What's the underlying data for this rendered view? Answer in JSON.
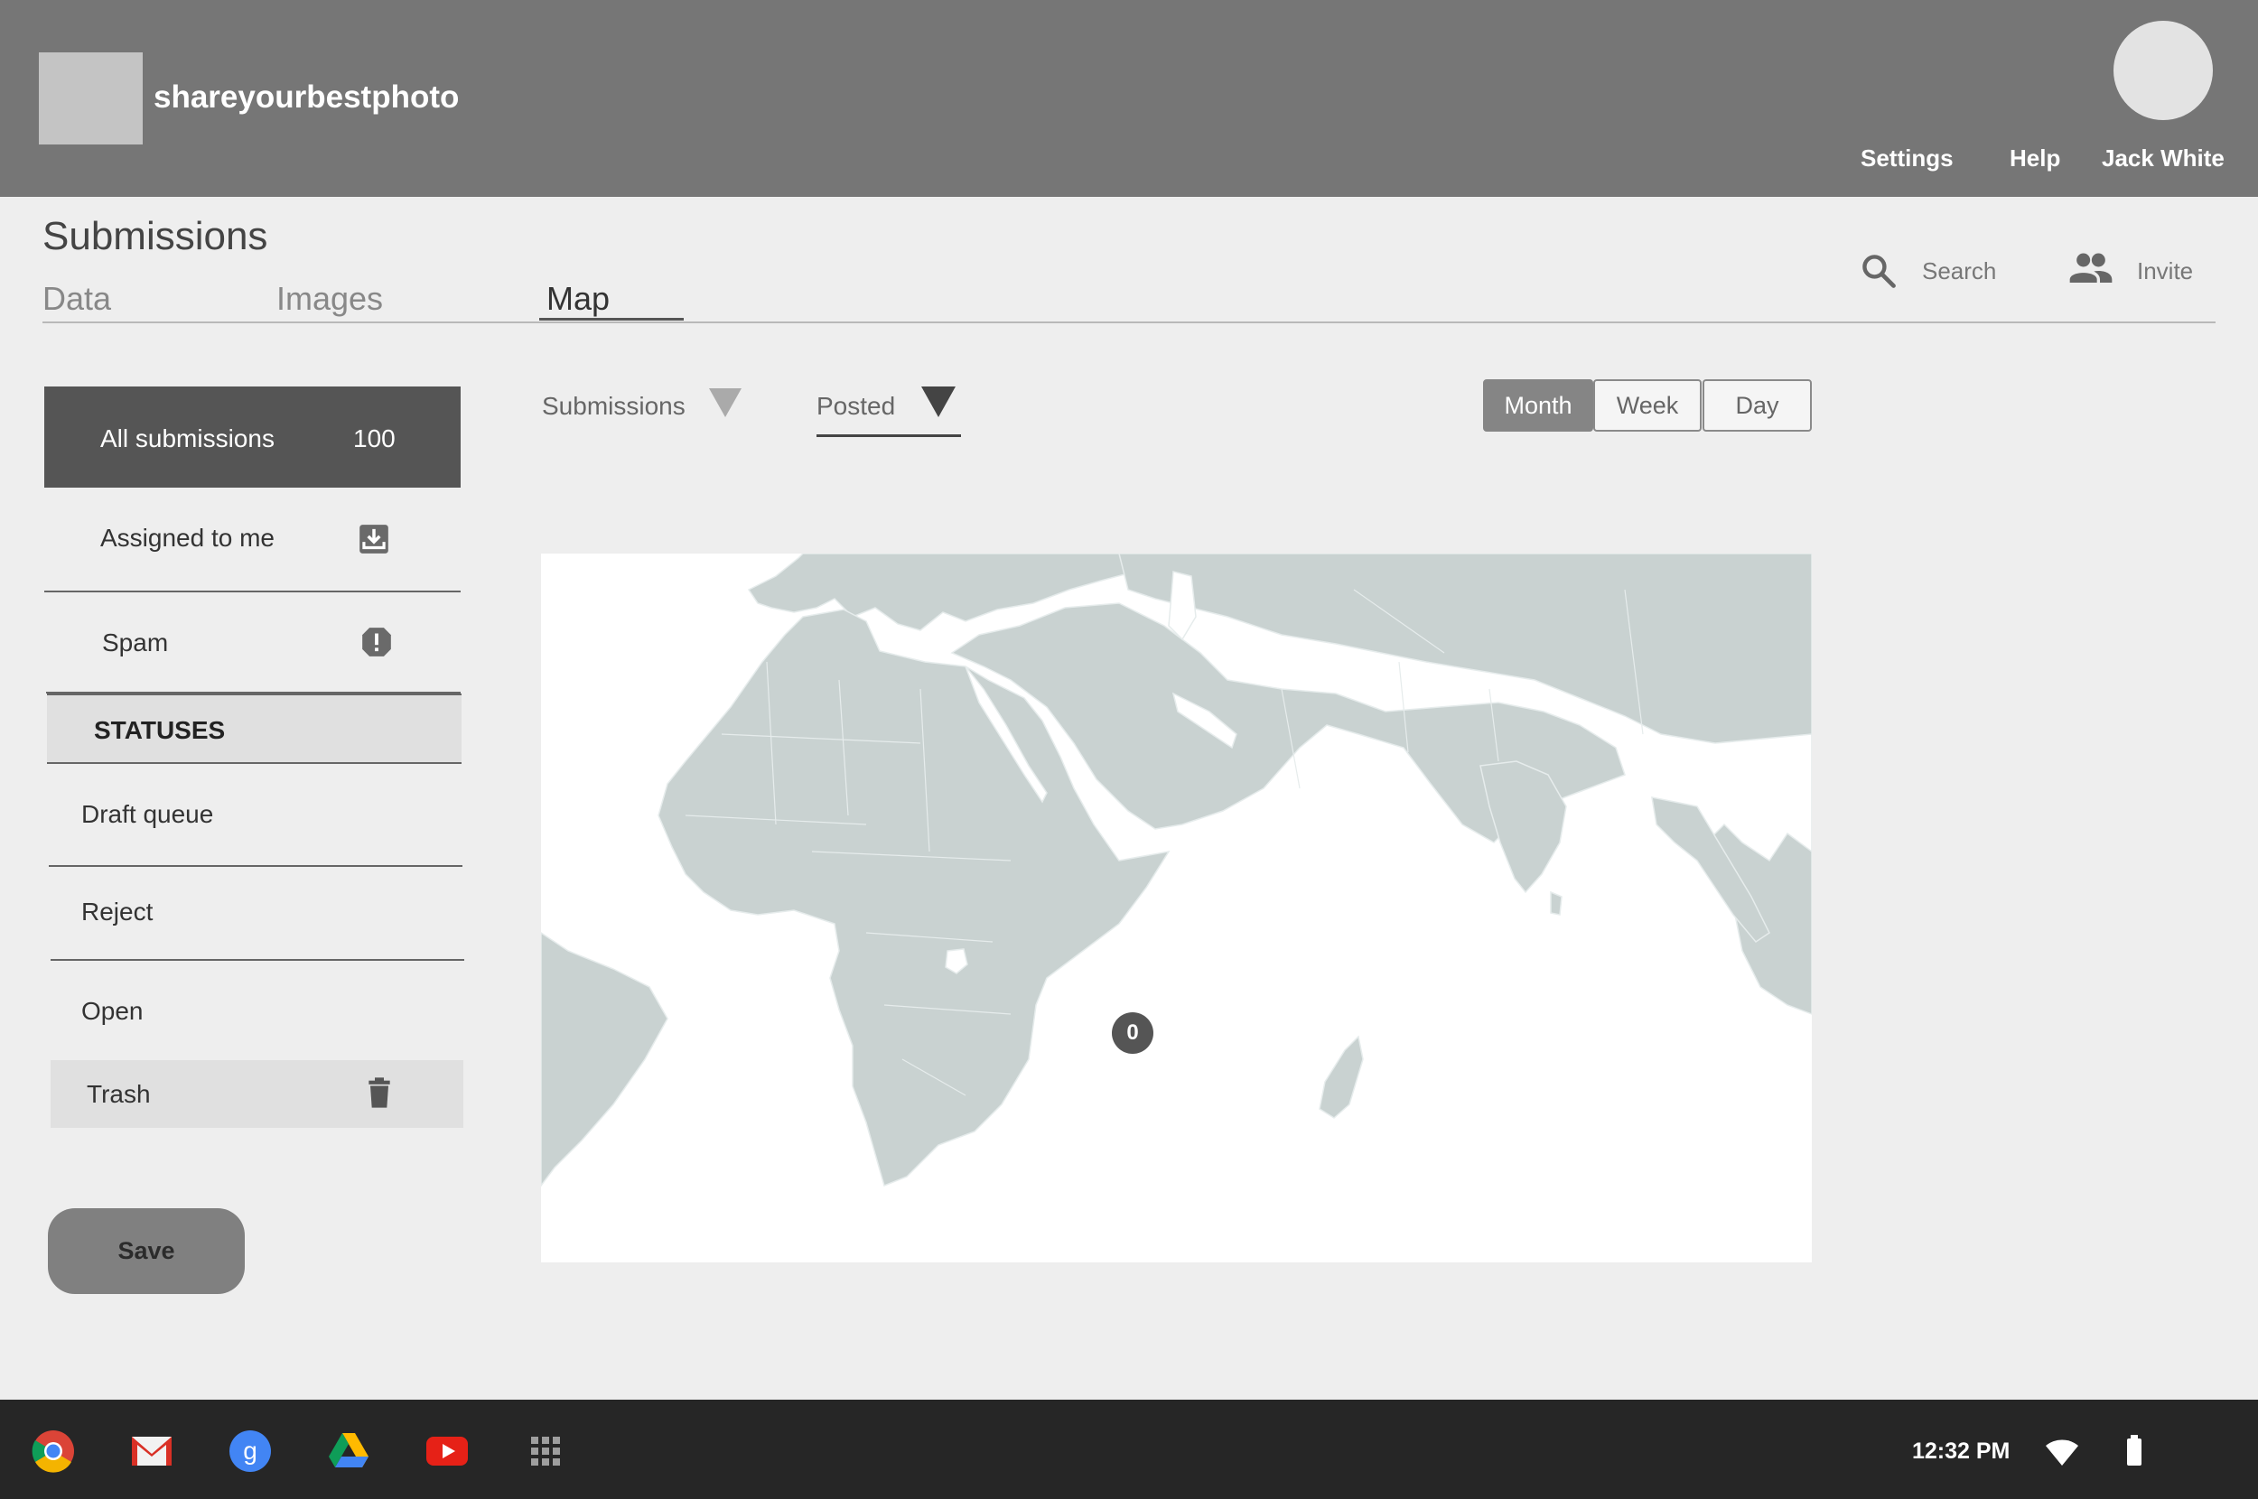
{
  "header": {
    "app_title": "shareyourbestphoto",
    "settings_label": "Settings",
    "help_label": "Help",
    "user_name": "Jack White"
  },
  "page": {
    "title": "Submissions",
    "tabs": [
      {
        "label": "Data",
        "active": false
      },
      {
        "label": "Images",
        "active": false
      },
      {
        "label": "Map",
        "active": true
      }
    ],
    "search_label": "Search",
    "invite_label": "Invite"
  },
  "sidebar": {
    "all_submissions": {
      "label": "All submissions",
      "count": "100"
    },
    "assigned_to_me": {
      "label": "Assigned to me",
      "icon": "inbox-download-icon"
    },
    "spam": {
      "label": "Spam",
      "icon": "alert-octagon-icon"
    },
    "statuses_header": "STATUSES",
    "statuses": [
      {
        "label": "Draft queue"
      },
      {
        "label": "Reject"
      },
      {
        "label": "Open"
      }
    ],
    "trash": {
      "label": "Trash",
      "icon": "trash-icon"
    },
    "save_label": "Save"
  },
  "filters": {
    "submissions_label": "Submissions",
    "posted_label": "Posted",
    "period": {
      "options": [
        "Month",
        "Week",
        "Day"
      ],
      "selected": "Month"
    }
  },
  "map": {
    "region": "Africa, Middle East and South Asia",
    "marker_count": "0"
  },
  "taskbar": {
    "apps": [
      "chrome-icon",
      "gmail-icon",
      "google-plus-icon",
      "drive-icon",
      "youtube-icon",
      "app-launcher-icon"
    ],
    "time": "12:32 PM"
  },
  "colors": {
    "header_bg": "#767676",
    "active_item_bg": "#555555",
    "land": "#c9d2d1",
    "taskbar_bg": "#262626"
  }
}
